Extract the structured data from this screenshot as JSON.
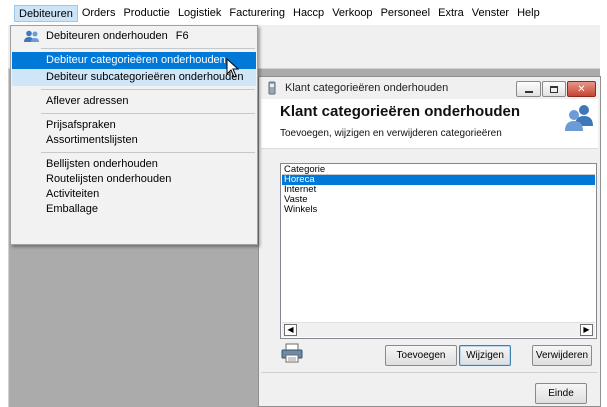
{
  "menubar": {
    "items": [
      "Debiteuren",
      "Orders",
      "Productie",
      "Logistiek",
      "Facturering",
      "Haccp",
      "Verkoop",
      "Personeel",
      "Extra",
      "Venster",
      "Help"
    ]
  },
  "dropdown": {
    "items": [
      {
        "label": "Debiteuren onderhouden",
        "shortcut": "F6"
      },
      {
        "label": "Debiteur categorieëren onderhouden"
      },
      {
        "label": "Debiteur subcategorieëren onderhouden"
      },
      {
        "label": "Aflever adressen"
      },
      {
        "label": "Prijsafspraken"
      },
      {
        "label": "Assortimentslijsten"
      },
      {
        "label": "Bellijsten onderhouden"
      },
      {
        "label": "Routelijsten onderhouden"
      },
      {
        "label": "Activiteiten"
      },
      {
        "label": "Emballage"
      }
    ]
  },
  "window": {
    "title": "Klant categorieëren onderhouden",
    "heading": "Klant categorieëren onderhouden",
    "subtitle": "Toevoegen, wijzigen en verwijderen categorieëren",
    "list": {
      "header": "Categorie",
      "rows": [
        "Horeca",
        "Internet",
        "Vaste",
        "Winkels"
      ],
      "selected_index": 0
    },
    "buttons": {
      "add": "Toevoegen",
      "edit": "Wijzigen",
      "delete": "Verwijderen",
      "close": "Einde"
    }
  },
  "colors": {
    "selection": "#0078d7",
    "workspace": "#ababab",
    "menu_highlight": "#cce4f7"
  }
}
